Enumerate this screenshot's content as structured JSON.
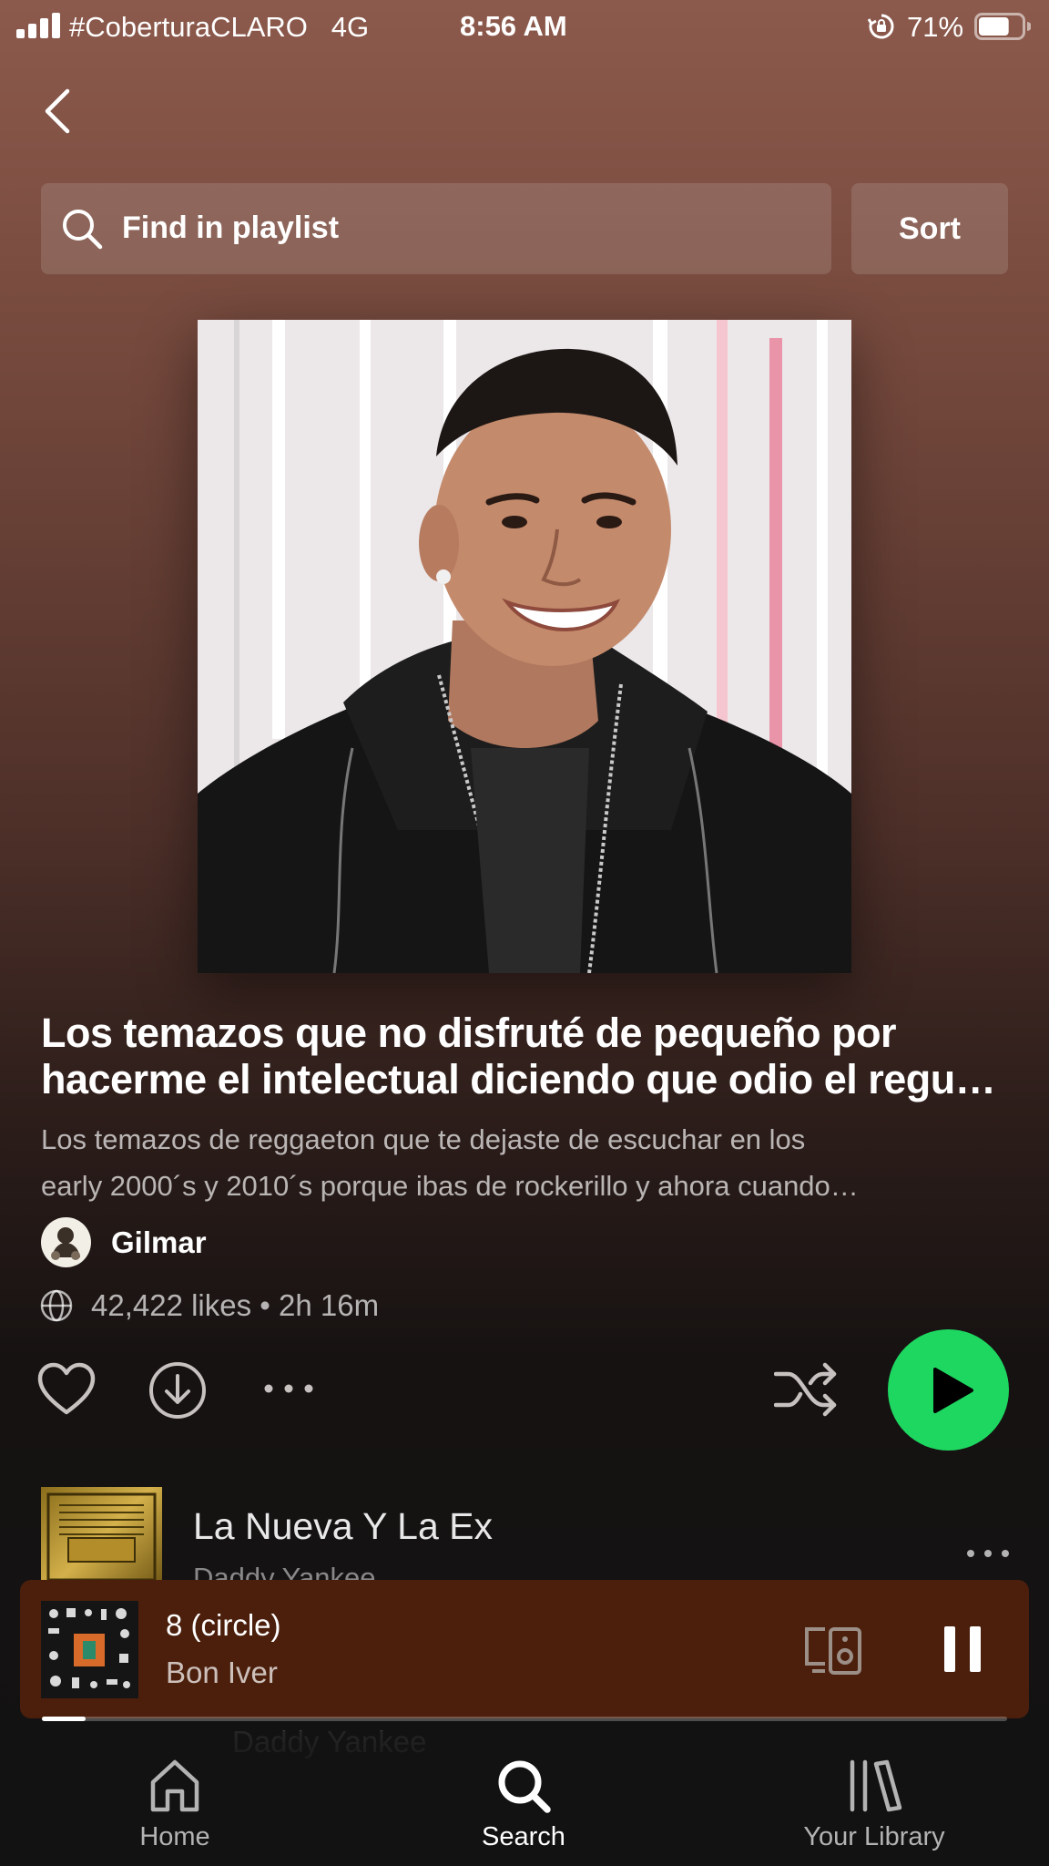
{
  "status_bar": {
    "carrier": "#CoberturaCLARO",
    "network": "4G",
    "time": "8:56 AM",
    "battery_percent": "71%",
    "battery_level": 0.71,
    "icons": [
      "signal-icon",
      "rotation-lock-icon",
      "battery-icon"
    ]
  },
  "nav": {
    "back_icon": "chevron-left-icon"
  },
  "search": {
    "placeholder": "Find in playlist",
    "icon": "search-icon",
    "sort_label": "Sort"
  },
  "playlist": {
    "title": "Los temazos que no disfruté de pequeño por\nhacerme el intelectual diciendo que odio el regu…",
    "description": "Los temazos de reggaeton que te dejaste de escuchar en los\nearly 2000´s y 2010´s porque ibas de rockerillo y ahora cuando…",
    "owner": "Gilmar",
    "meta": "42,422 likes • 2h 16m",
    "cover_alt": "playlist-cover-image"
  },
  "actions": {
    "icons": [
      "heart-icon",
      "download-icon",
      "more-icon",
      "shuffle-icon",
      "play-icon"
    ]
  },
  "tracks": [
    {
      "title": "La Nueva Y La Ex",
      "artist": "Daddy Yankee"
    }
  ],
  "now_playing": {
    "title": "8 (circle)",
    "artist": "Bon Iver",
    "progress": 0.045
  },
  "ghost_row_text": "Daddy Yankee",
  "tabbar": {
    "tabs": [
      {
        "label": "Home",
        "icon": "home-icon",
        "active": false
      },
      {
        "label": "Search",
        "icon": "search-icon",
        "active": true
      },
      {
        "label": "Your Library",
        "icon": "library-icon",
        "active": false
      }
    ]
  },
  "colors": {
    "accent_green": "#1ed760",
    "mini_player_bg": "#4b1f0c",
    "header_gradient_top": "#8c5a4c"
  }
}
